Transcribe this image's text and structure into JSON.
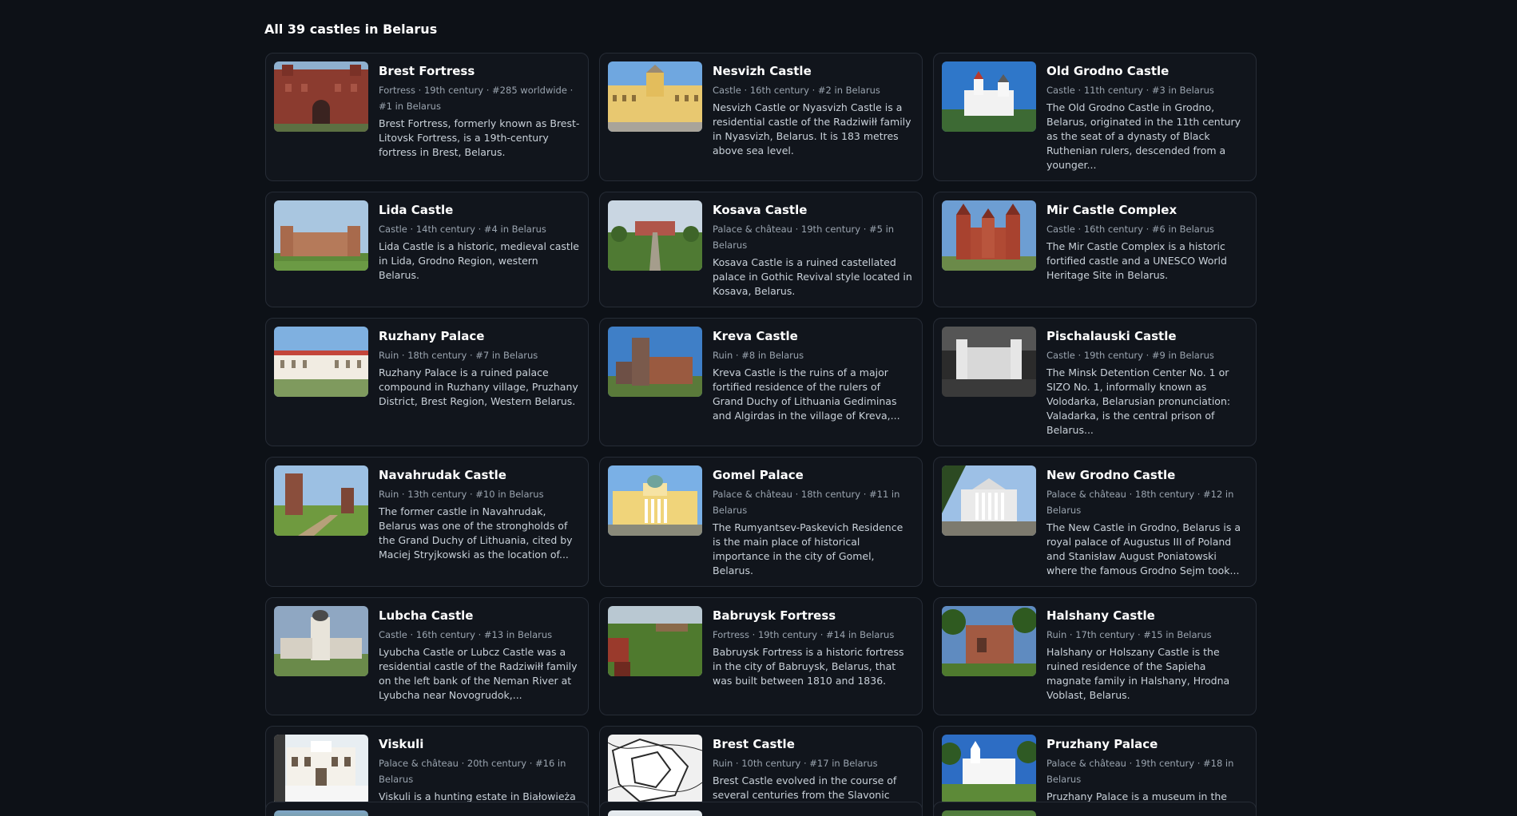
{
  "heading": "All 39 castles in Belarus",
  "castles": [
    {
      "name": "Brest Fortress",
      "meta": "Fortress · 19th century · #285 worldwide · #1 in Belarus",
      "desc": "Brest Fortress, formerly known as Brest-Litovsk Fortress, is a 19th-century fortress in Brest, Belarus.",
      "thumb": "brick-fortress"
    },
    {
      "name": "Nesvizh Castle",
      "meta": "Castle · 16th century · #2 in Belarus",
      "desc": "Nesvizh Castle or Nyasvizh Castle is a residential castle of the Radziwiłł family in Nyasvizh, Belarus. It is 183 metres above sea level.",
      "thumb": "yellow-palace"
    },
    {
      "name": "Old Grodno Castle",
      "meta": "Castle · 11th century · #3 in Belarus",
      "desc": "The Old Grodno Castle in Grodno, Belarus, originated in the 11th century as the seat of a dynasty of Black Ruthenian rulers, descended from a younger...",
      "thumb": "white-castle-sky"
    },
    {
      "name": "Lida Castle",
      "meta": "Castle · 14th century · #4 in Belarus",
      "desc": "Lida Castle is a historic, medieval castle in Lida, Grodno Region, western Belarus.",
      "thumb": "brick-wall-field"
    },
    {
      "name": "Kosava Castle",
      "meta": "Palace & château · 19th century · #5 in Belarus",
      "desc": "Kosava Castle is a ruined castellated palace in Gothic Revival style located in Kosava, Belarus.",
      "thumb": "path-palace"
    },
    {
      "name": "Mir Castle Complex",
      "meta": "Castle · 16th century · #6 in Belarus",
      "desc": "The Mir Castle Complex is a historic fortified castle and a UNESCO World Heritage Site in Belarus.",
      "thumb": "red-towers"
    },
    {
      "name": "Ruzhany Palace",
      "meta": "Ruin · 18th century · #7 in Belarus",
      "desc": "Ruzhany Palace is a ruined palace compound in Ruzhany village, Pruzhany District, Brest Region, Western Belarus.",
      "thumb": "white-palace-front"
    },
    {
      "name": "Kreva Castle",
      "meta": "Ruin · #8 in Belarus",
      "desc": "Kreva Castle is the ruins of a major fortified residence of the rulers of Grand Duchy of Lithuania Gediminas and Algirdas in the village of Kreva,...",
      "thumb": "ruin-tower"
    },
    {
      "name": "Pischalauski Castle",
      "meta": "Castle · 19th century · #9 in Belarus",
      "desc": "The Minsk Detention Center No. 1 or SIZO No. 1, informally known as Volodarka, Belarusian pronunciation: Valadarka, is the central prison of Belarus...",
      "thumb": "bw-castle"
    },
    {
      "name": "Navahrudak Castle",
      "meta": "Ruin · 13th century · #10 in Belarus",
      "desc": "The former castle in Navahrudak, Belarus was one of the strongholds of the Grand Duchy of Lithuania, cited by Maciej Stryjkowski as the location of...",
      "thumb": "ruin-hill"
    },
    {
      "name": "Gomel Palace",
      "meta": "Palace & château · 18th century · #11 in Belarus",
      "desc": "The Rumyantsev-Paskevich Residence is the main place of historical importance in the city of Gomel, Belarus.",
      "thumb": "yellow-palace-dome"
    },
    {
      "name": "New Grodno Castle",
      "meta": "Palace & château · 18th century · #12 in Belarus",
      "desc": "The New Castle in Grodno, Belarus is a royal palace of Augustus III of Poland and Stanisław August Poniatowski where the famous Grodno Sejm took...",
      "thumb": "white-columns"
    },
    {
      "name": "Lubcha Castle",
      "meta": "Castle · 16th century · #13 in Belarus",
      "desc": "Lyubcha Castle or Lubcz Castle was a residential castle of the Radziwiłł family on the left bank of the Neman River at Lyubcha near Novogrudok,...",
      "thumb": "tower-cloudy"
    },
    {
      "name": "Babruysk Fortress",
      "meta": "Fortress · 19th century · #14 in Belarus",
      "desc": "Babruysk Fortress is a historic fortress in the city of Babruysk, Belarus, that was built between 1810 and 1836.",
      "thumb": "green-fort"
    },
    {
      "name": "Halshany Castle",
      "meta": "Ruin · 17th century · #15 in Belarus",
      "desc": "Halshany or Holszany Castle is the ruined residence of the Sapieha magnate family in Halshany, Hrodna Voblast, Belarus.",
      "thumb": "ruin-trees"
    },
    {
      "name": "Viskuli",
      "meta": "Palace & château · 20th century · #16 in Belarus",
      "desc": "Viskuli is a hunting estate in Białowieża Forest, in Pruzhany District, Brest Region, Belarus, named after the former khutor Viskuli nearby, about 8...",
      "thumb": "winter-house"
    },
    {
      "name": "Brest Castle",
      "meta": "Ruin · 10th century · #17 in Belarus",
      "desc": "Brest Castle evolved in the course of several centuries from the Slavonic fortified settlement Berestye that had appeared at the turn of the 10th and...",
      "thumb": "map-sketch"
    },
    {
      "name": "Pruzhany Palace",
      "meta": "Palace & château · 19th century · #18 in Belarus",
      "desc": "Pruzhany Palace is a museum in the town of Pruzhany, Brest region, western Belarus. It is a 19th-century mansion, at 50 Savetskaya Street.",
      "thumb": "white-manor"
    }
  ],
  "colors": {
    "background": "#0d1117",
    "card": "#11151c",
    "border": "#262c36",
    "title": "#ffffff",
    "meta": "#9aa4af",
    "desc": "#c9d1d9"
  }
}
